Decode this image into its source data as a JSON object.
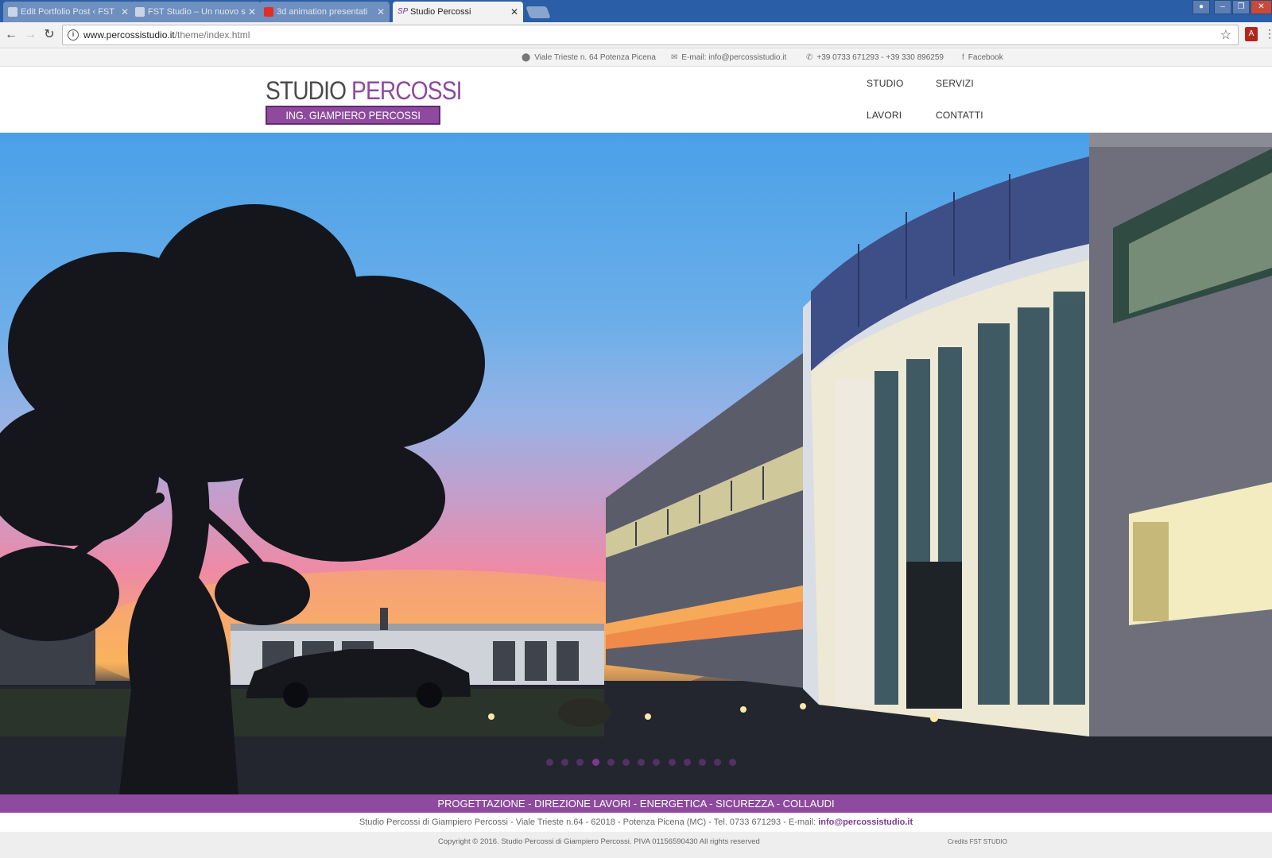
{
  "browser": {
    "tabs": [
      {
        "title": "Edit Portfolio Post ‹ FST"
      },
      {
        "title": "FST Studio – Un nuovo s"
      },
      {
        "title": "3d animation presentati"
      },
      {
        "title": "Studio Percossi",
        "favicon": "SP"
      }
    ],
    "url_domain": "www.percossistudio.it",
    "url_path": "/theme/index.html"
  },
  "infobar": {
    "address": "Viale Trieste n. 64 Potenza Picena",
    "email": "E-mail: info@percossistudio.it",
    "phone": "+39 0733 671293 - +39 330 896259",
    "facebook": "Facebook"
  },
  "logo": {
    "studio": "STUDIO",
    "percossi": "PERCOSSI",
    "subtitle": "ING. GIAMPIERO PERCOSSI"
  },
  "menu": {
    "studio": "STUDIO",
    "servizi": "SERVIZI",
    "lavori": "LAVORI",
    "contatti": "CONTATTI"
  },
  "slider": {
    "slide_count": 13,
    "active_index": 3
  },
  "footer": {
    "services": "PROGETTAZIONE - DIREZIONE LAVORI - ENERGETICA - SICUREZZA - COLLAUDI",
    "address_line": "Studio Percossi di Giampiero Percossi - Viale Trieste n.64 - 62018 - Potenza Picena (MC) - Tel. 0733 671293 - E-mail:",
    "email": "info@percossistudio.it",
    "copyright": "Copyright © 2016. Studio Percossi di Giampiero Percossi. PIVA 01156590430 All rights reserved",
    "credits": "Credits FST STUDIO"
  },
  "colors": {
    "brand_purple": "#8e4a9e",
    "chrome_blue": "#2a5ea7"
  }
}
